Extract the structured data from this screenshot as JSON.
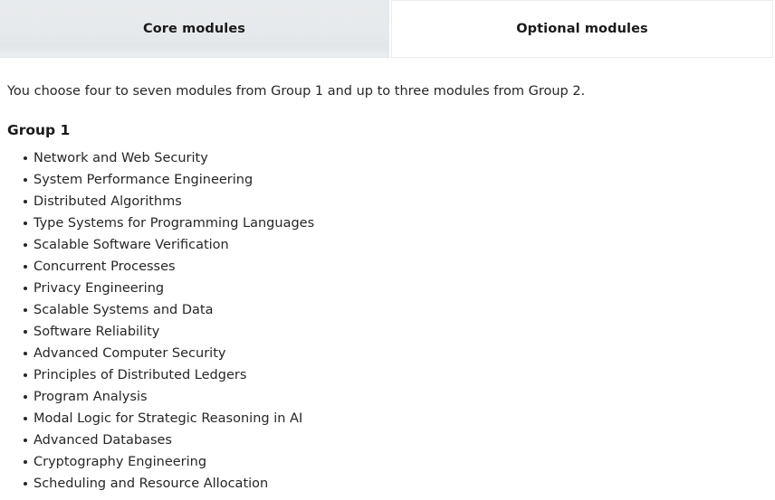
{
  "tabs": [
    {
      "id": "core-modules",
      "label": "Core modules",
      "selected": true
    },
    {
      "id": "optional-modules",
      "label": "Optional modules",
      "selected": false
    }
  ],
  "main": {
    "intro": "You choose four to seven modules from Group 1 and up to three modules from Group 2.",
    "group_heading": "Group 1",
    "modules": [
      "Network and Web Security",
      "System Performance Engineering",
      "Distributed Algorithms",
      "Type Systems for Programming Languages",
      "Scalable Software Verification",
      "Concurrent Processes",
      "Privacy Engineering",
      "Scalable Systems and Data",
      "Software Reliability",
      "Advanced Computer Security",
      "Principles of Distributed Ledgers",
      "Program Analysis",
      "Modal Logic for Strategic Reasoning in AI",
      "Advanced Databases",
      "Cryptography Engineering",
      "Scheduling and Resource Allocation"
    ]
  },
  "colors": {
    "tab_selected_bg": "#e8ebed",
    "tab_unselected_bg": "#ffffff",
    "tab_border": "#e3e7e9",
    "text": "#262626",
    "heading": "#1a1a1a",
    "page_bg": "#ffffff"
  }
}
